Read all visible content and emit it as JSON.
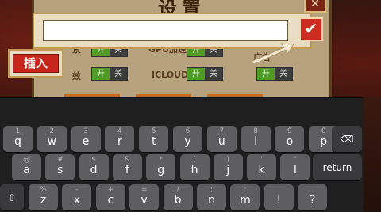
{
  "settings": {
    "title": "设置",
    "close_label": "✕",
    "rows": [
      {
        "label": "GPU加速",
        "on_label": "开",
        "off_label": "关"
      },
      {
        "label": "ICLOUD",
        "on_label": "开",
        "off_label": "关"
      }
    ],
    "partial_labels": [
      "景",
      "效",
      "广告"
    ]
  },
  "popup": {
    "input_value": "",
    "confirm_label": "✔",
    "insert_label": "插入"
  },
  "keyboard": {
    "row1": [
      {
        "k": "q",
        "s": "1"
      },
      {
        "k": "w",
        "s": "2"
      },
      {
        "k": "e",
        "s": "3"
      },
      {
        "k": "r",
        "s": "4"
      },
      {
        "k": "t",
        "s": "5"
      },
      {
        "k": "y",
        "s": "6"
      },
      {
        "k": "u",
        "s": "7"
      },
      {
        "k": "i",
        "s": "8"
      },
      {
        "k": "o",
        "s": "9"
      },
      {
        "k": "p",
        "s": "0"
      }
    ],
    "row2": [
      {
        "k": "a",
        "s": "@"
      },
      {
        "k": "s",
        "s": "#"
      },
      {
        "k": "d",
        "s": "$"
      },
      {
        "k": "f",
        "s": "&"
      },
      {
        "k": "g",
        "s": "*"
      },
      {
        "k": "h",
        "s": "("
      },
      {
        "k": "j",
        "s": ")"
      },
      {
        "k": "k",
        "s": "'"
      },
      {
        "k": "l",
        "s": "\""
      }
    ],
    "row3": [
      {
        "k": "z",
        "s": "%"
      },
      {
        "k": "x",
        "s": "-"
      },
      {
        "k": "c",
        "s": "+"
      },
      {
        "k": "v",
        "s": "="
      },
      {
        "k": "b",
        "s": "/"
      },
      {
        "k": "n",
        "s": ";"
      },
      {
        "k": "m",
        "s": ":"
      },
      {
        "k": "!",
        "s": "!"
      },
      {
        "k": "?",
        "s": "?"
      }
    ],
    "delete_label": "⌫",
    "return_label": "return",
    "shift_label": "⇧"
  }
}
